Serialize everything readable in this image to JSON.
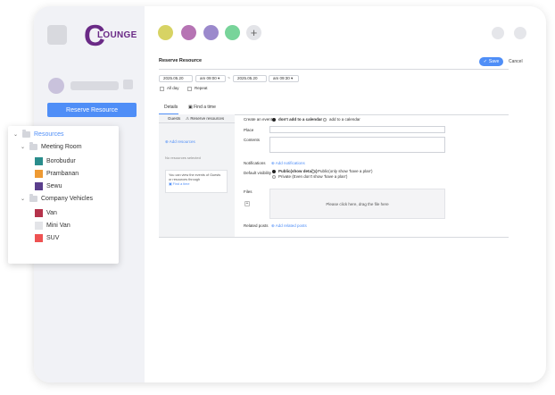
{
  "logo": {
    "letter": "C",
    "text": "LOUNGE"
  },
  "sidebar": {
    "reserve_button": "Reserve Resource"
  },
  "top": {
    "calendar_colors": [
      "#d7d364",
      "#b674b4",
      "#9b89cc",
      "#78d49a"
    ],
    "add_symbol": "+"
  },
  "form": {
    "title": "Reserve Resource",
    "save_label": "Save",
    "cancel_label": "Cancel",
    "start_date": "2025.05.20",
    "start_time": "am 09:00",
    "range_sep": "~",
    "end_date": "2025.05.20",
    "end_time": "am 09:30",
    "all_day": "All day",
    "repeat": "Repeat",
    "tabs": {
      "details": "Details",
      "find_time": "Find a time"
    },
    "left": {
      "tab_guests": "Guests",
      "tab_resources": "Reserve resources",
      "add_resources": "Add resources",
      "no_resources": "No resources selected",
      "hint": "You can view the events of Guests or resources through",
      "hint_link": "Find a time"
    },
    "create_event_label": "Create an event",
    "opt_dont_add": "don't add to a calendar",
    "opt_add": "add to a calendar",
    "place_label": "Place",
    "contents_label": "Contents",
    "notifications_label": "Notifications",
    "add_notifications": "Add notifications",
    "visibility_label": "Default visibility",
    "vis_public_details": "Public(show details)",
    "vis_public_only": "Public(only show 'have a plan')",
    "vis_private": "Private (Even don't show 'have a plan')",
    "files_label": "Files",
    "dropzone": "Please click here, drag the file here",
    "related_posts_label": "Related posts",
    "add_related_posts": "Add related posts"
  },
  "tree": {
    "root": "Resources",
    "groups": [
      {
        "name": "Meeting Room",
        "items": [
          {
            "name": "Borobudur",
            "color": "#2a8d8c"
          },
          {
            "name": "Prambanan",
            "color": "#ee9a33"
          },
          {
            "name": "Sewu",
            "color": "#5a3e8c"
          }
        ]
      },
      {
        "name": "Company Vehicles",
        "items": [
          {
            "name": "Van",
            "color": "#b5334b"
          },
          {
            "name": "Mini Van",
            "color": "#e3e4e8"
          },
          {
            "name": "SUV",
            "color": "#ee5252"
          }
        ]
      }
    ]
  }
}
